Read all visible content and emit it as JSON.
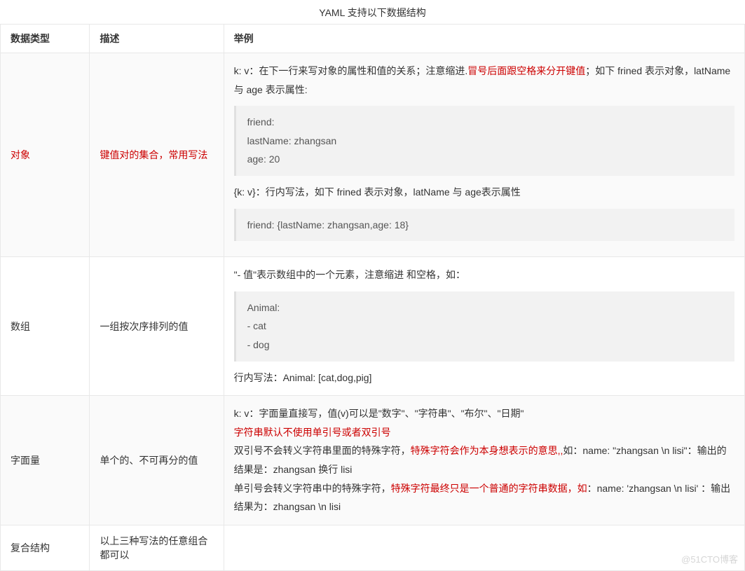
{
  "title": "YAML 支持以下数据结构",
  "headers": [
    "数据类型",
    "描述",
    "举例"
  ],
  "rows": {
    "object": {
      "type": "对象",
      "desc": "键值对的集合，常用写法",
      "ex_pre1_a": "k: v：在下一行来写对象的属性和值的关系；注意缩进.",
      "ex_pre1_b": "冒号后面跟空格来分开键值",
      "ex_pre1_c": "；如下 frined 表示对象，latName  与 age 表示属性:",
      "code1_l1": "friend:",
      "code1_l2": " lastName: zhangsan",
      "code1_l3": "  age: 20",
      "ex_mid": "{k: v}：行内写法，如下 frined 表示对象，latName 与 age表示属性",
      "code2_l1": "friend: {lastName: zhangsan,age: 18}"
    },
    "array": {
      "type": "数组",
      "desc": "一组按次序排列的值",
      "ex_pre": "\"- 值\"表示数组中的一个元素，注意缩进 和空格，如：",
      "code_l1": "Animal:",
      "code_l2": " - cat",
      "code_l3": " - dog",
      "ex_post": "行内写法：Animal: [cat,dog,pig]"
    },
    "literal": {
      "type": "字面量",
      "desc": "单个的、不可再分的值",
      "l1": "k: v：字面量直接写，值(v)可以是\"数字\"、\"字符串\"、\"布尔\"、\"日期\"",
      "l2": "字符串默认不使用单引号或者双引号",
      "l3a": "双引号不会转义字符串里面的特殊字符，",
      "l3b": "特殊字符会作为本身想表示的意思,,",
      "l3c": "如：name: \"zhangsan \\n lisi\"：输出的结果是：zhangsan 换行 lisi",
      "l4a": "单引号会转义字符串中的特殊字符，",
      "l4b": "特殊字符最终只是一个普通的字符串数据，如",
      "l4c": "：name: 'zhangsan \\n lisi' ：输出结果为：zhangsan \\n lisi"
    },
    "compound": {
      "type": "复合结构",
      "desc": "以上三种写法的任意组合都可以",
      "ex": ""
    }
  },
  "watermark": "@51CTO博客"
}
